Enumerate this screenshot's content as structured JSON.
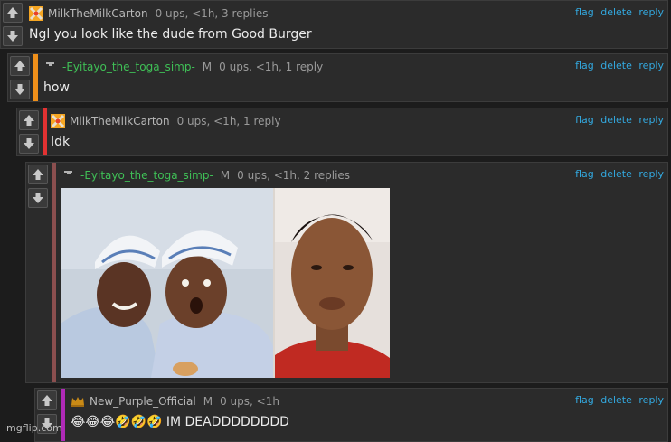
{
  "actions": {
    "flag": "flag",
    "delete": "delete",
    "reply": "reply"
  },
  "comments": [
    {
      "username": "MilkTheMilkCarton",
      "mod": "",
      "meta": "0 ups, <1h, 3 replies",
      "text": "Ngl you look like the dude from Good Burger",
      "bar_color": "",
      "avatar_icon": "orange-x-avatar-icon"
    },
    {
      "username": "-Eyitayo_the_toga_simp-",
      "mod": "M",
      "meta": "0 ups, <1h, 1 reply",
      "text": "how",
      "bar_color": "#f0901a",
      "avatar_icon": "small-dash-avatar-icon"
    },
    {
      "username": "MilkTheMilkCarton",
      "mod": "",
      "meta": "0 ups, <1h, 1 reply",
      "text": "Idk",
      "bar_color": "#e23232",
      "avatar_icon": "orange-x-avatar-icon"
    },
    {
      "username": "-Eyitayo_the_toga_simp-",
      "mod": "M",
      "meta": "0 ups, <1h, 2 replies",
      "text": "",
      "bar_color": "#8b4f4f",
      "avatar_icon": "small-dash-avatar-icon",
      "image": "good-burger-comparison-meme"
    },
    {
      "username": "New_Purple_Official",
      "mod": "M",
      "meta": "0 ups, <1h",
      "text": "😂😂😂🤣🤣🤣 IM DEADDDDDDDD",
      "bar_color": "#b02ab8",
      "avatar_icon": "crown-avatar-icon"
    }
  ],
  "watermark": "imgflip.com"
}
